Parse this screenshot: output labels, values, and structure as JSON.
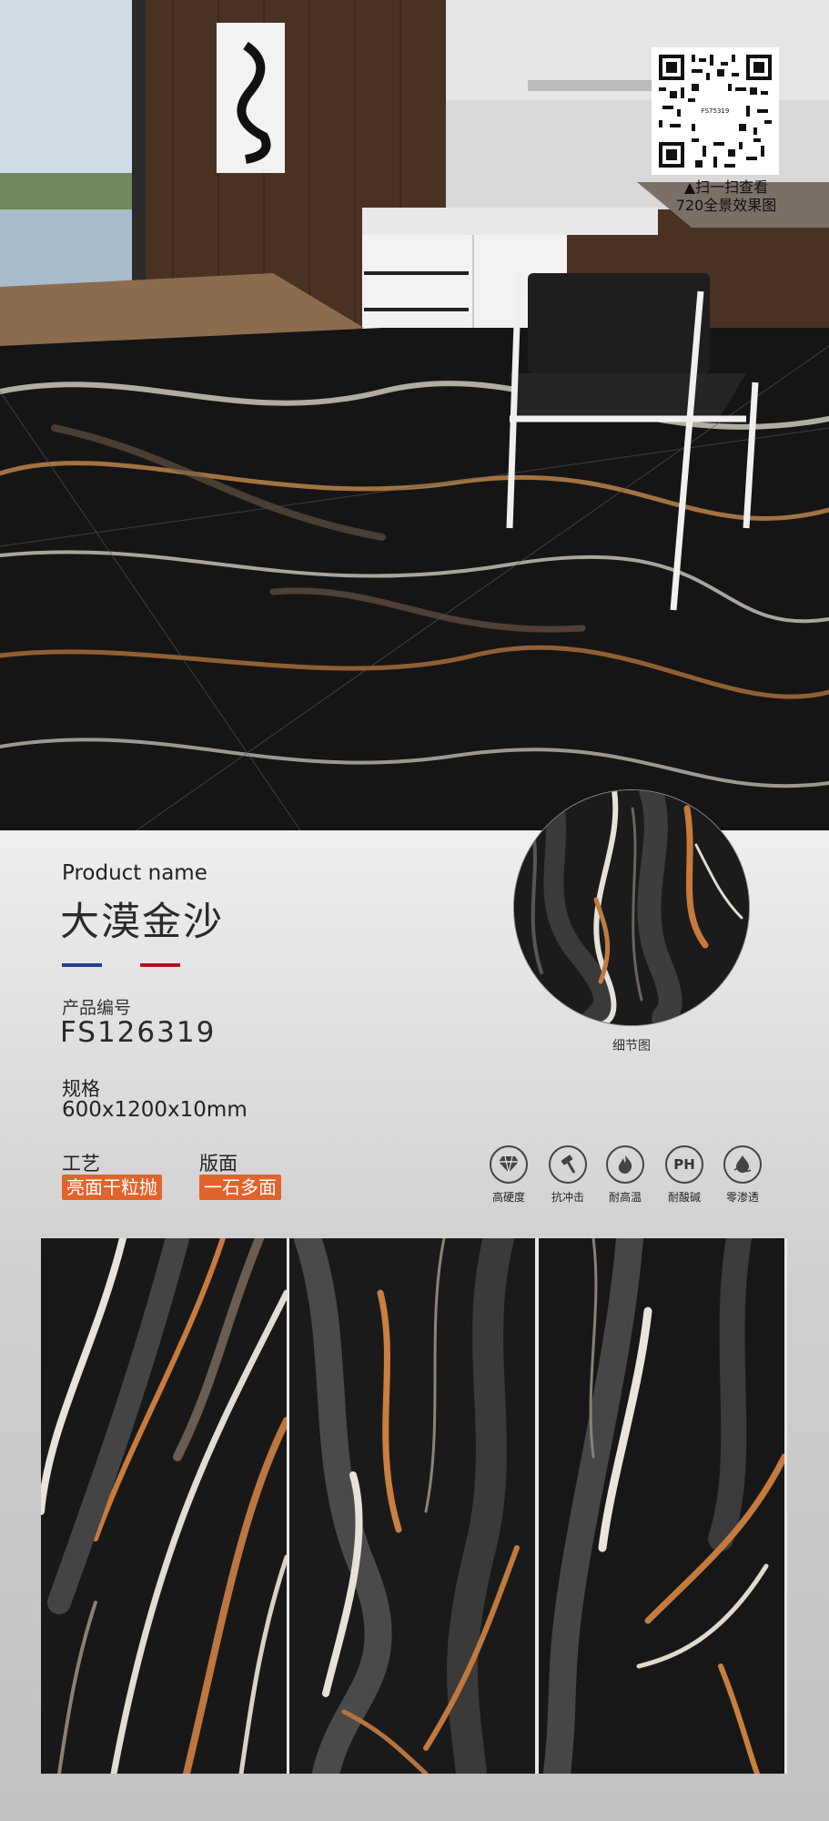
{
  "qr": {
    "code_text": "FS75319",
    "caption_line1": "▲扫一扫查看",
    "caption_line2": "720全景效果图"
  },
  "product": {
    "name_label_en": "Product name",
    "name": "大漠金沙",
    "code_label": "产品编号",
    "code": "FS126319",
    "spec_label": "规格",
    "spec": "600x1200x10mm",
    "craft_label": "工艺",
    "craft": "亮面干粒抛",
    "face_label": "版面",
    "face": "一石多面"
  },
  "flag_colors": [
    "#233f8c",
    "#e6e6e6",
    "#b0141f"
  ],
  "detail_caption": "细节图",
  "features": [
    {
      "icon": "diamond-icon",
      "label": "高硬度"
    },
    {
      "icon": "hammer-icon",
      "label": "抗冲击"
    },
    {
      "icon": "flame-icon",
      "label": "耐高温"
    },
    {
      "icon": "ph-icon",
      "icon_text": "PH",
      "label": "耐酸碱"
    },
    {
      "icon": "drop-icon",
      "label": "零渗透"
    }
  ],
  "accent_color": "#e2642c"
}
